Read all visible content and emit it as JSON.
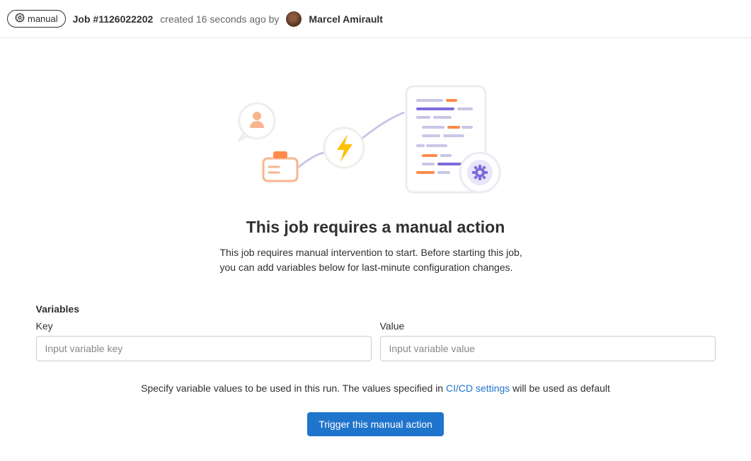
{
  "header": {
    "badge_label": "manual",
    "job_id": "Job #1126022202",
    "created_text": "created 16 seconds ago by",
    "author_name": "Marcel Amirault"
  },
  "main": {
    "heading": "This job requires a manual action",
    "description": "This job requires manual intervention to start. Before starting this job, you can add variables below for last-minute configuration changes."
  },
  "variables": {
    "section_label": "Variables",
    "key_label": "Key",
    "key_placeholder": "Input variable key",
    "value_label": "Value",
    "value_placeholder": "Input variable value"
  },
  "helper": {
    "prefix": "Specify variable values to be used in this run. The values specified in ",
    "link_text": "CI/CD settings",
    "suffix": " will be used as default"
  },
  "actions": {
    "trigger_label": "Trigger this manual action"
  }
}
